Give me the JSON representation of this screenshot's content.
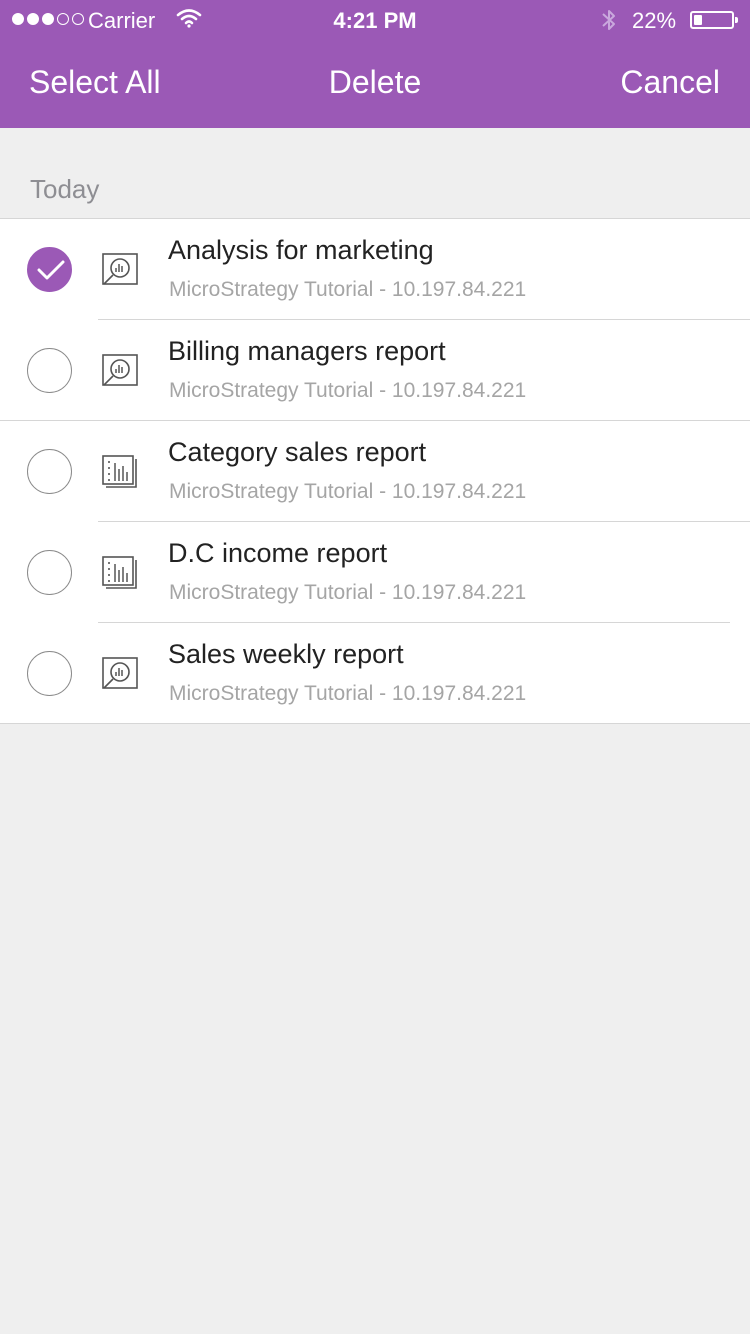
{
  "status_bar": {
    "carrier": "Carrier",
    "time": "4:21 PM",
    "battery": "22%",
    "battery_level": 0.22,
    "signal_bars": 3,
    "signal_total": 5
  },
  "nav": {
    "left": "Select All",
    "center": "Delete",
    "right": "Cancel"
  },
  "colors": {
    "accent": "#9b59b6",
    "background": "#efefef"
  },
  "section": {
    "title": "Today"
  },
  "items": [
    {
      "title": "Analysis for marketing",
      "subtitle": "MicroStrategy Tutorial - 10.197.84.221",
      "icon": "analysis-icon",
      "selected": true
    },
    {
      "title": "Billing managers report",
      "subtitle": "MicroStrategy Tutorial - 10.197.84.221",
      "icon": "analysis-icon",
      "selected": false
    },
    {
      "title": "Category sales report",
      "subtitle": "MicroStrategy Tutorial - 10.197.84.221",
      "icon": "report-grid-icon",
      "selected": false
    },
    {
      "title": "D.C income report",
      "subtitle": "MicroStrategy Tutorial - 10.197.84.221",
      "icon": "report-grid-icon",
      "selected": false
    },
    {
      "title": "Sales weekly report",
      "subtitle": "MicroStrategy Tutorial - 10.197.84.221",
      "icon": "analysis-icon",
      "selected": false
    }
  ]
}
